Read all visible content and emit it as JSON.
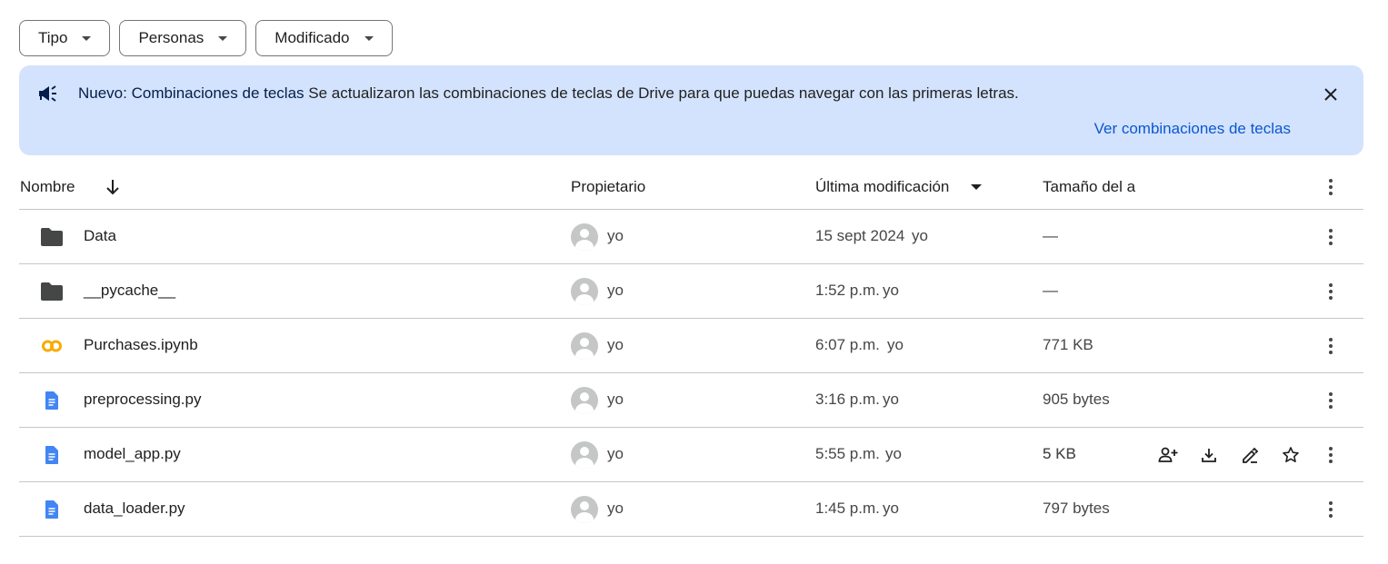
{
  "filters": [
    {
      "label": "Tipo"
    },
    {
      "label": "Personas"
    },
    {
      "label": "Modificado"
    }
  ],
  "banner": {
    "title": "Nuevo: Combinaciones de teclas",
    "message": "Se actualizaron las combinaciones de teclas de Drive para que puedas navegar con las primeras letras.",
    "link": "Ver combinaciones de teclas",
    "icon": "megaphone-icon"
  },
  "table": {
    "headers": {
      "name": "Nombre",
      "owner": "Propietario",
      "modified": "Última modificación",
      "size": "Tamaño del a"
    },
    "rows": [
      {
        "name": "Data",
        "icon": "folder-icon",
        "owner": "yo",
        "modified": "15 sept 2024",
        "modified_by": "yo",
        "size": "—"
      },
      {
        "name": "__pycache__",
        "icon": "folder-icon",
        "owner": "yo",
        "modified": "1:52 p.m.",
        "modified_by": "yo",
        "size": "—"
      },
      {
        "name": "Purchases.ipynb",
        "icon": "colab-icon",
        "owner": "yo",
        "modified": "6:07 p.m.",
        "modified_by": "yo",
        "size": "771 KB"
      },
      {
        "name": "preprocessing.py",
        "icon": "doc-file-icon",
        "owner": "yo",
        "modified": "3:16 p.m.",
        "modified_by": "yo",
        "size": "905 bytes"
      },
      {
        "name": "model_app.py",
        "icon": "doc-file-icon",
        "owner": "yo",
        "modified": "5:55 p.m.",
        "modified_by": "yo",
        "size": "5 KB"
      },
      {
        "name": "data_loader.py",
        "icon": "doc-file-icon",
        "owner": "yo",
        "modified": "1:45 p.m.",
        "modified_by": "yo",
        "size": "797 bytes"
      }
    ]
  },
  "colors": {
    "banner_bg": "#d3e3fd",
    "link": "#0b57d0",
    "folder": "#444746",
    "doc": "#4285f4",
    "colab": "#f9ab00"
  }
}
